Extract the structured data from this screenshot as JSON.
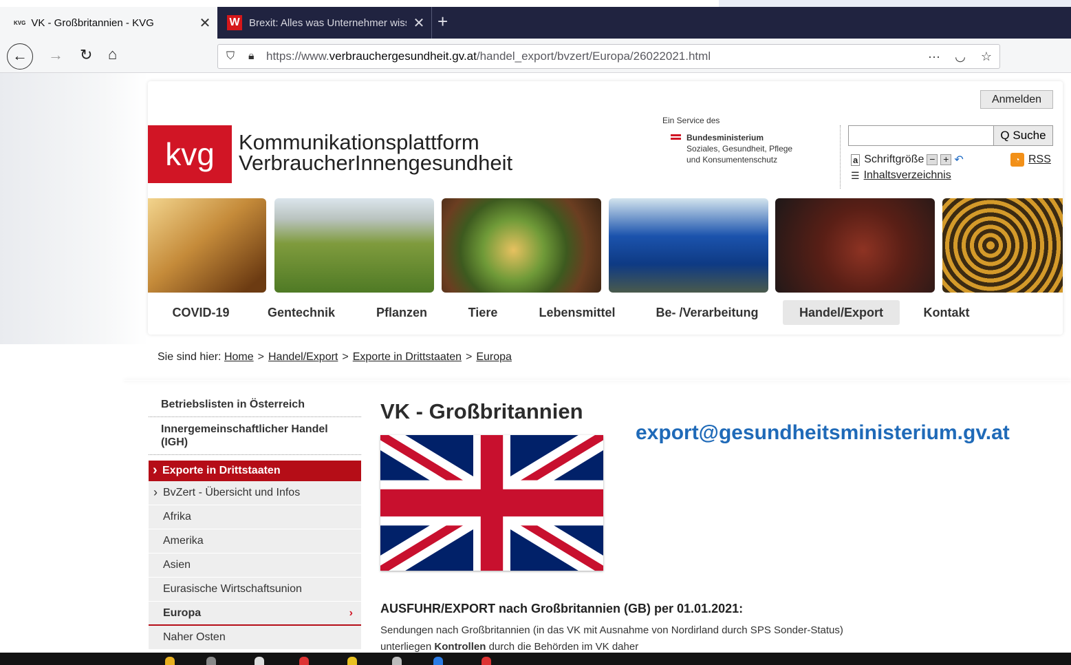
{
  "browser": {
    "tabs": [
      {
        "favicon": "KVG",
        "title": "VK - Großbritannien - KVG",
        "close": "✕"
      },
      {
        "favicon": "W",
        "title": "Brexit: Alles was Unternehmer wissen",
        "close": "✕"
      }
    ],
    "new_tab": "+",
    "url_prefix": "https://www.",
    "url_domain": "verbrauchergesundheit.gv.at",
    "url_path": "/handel_export/bvzert/Europa/26022021.html",
    "url_more": "···"
  },
  "header": {
    "login_label": "Anmelden",
    "logo_mark": "kvg",
    "logo_line1": "Kommunikationsplattform",
    "logo_line2": "VerbraucherInnengesundheit",
    "service_of": "Ein Service des",
    "ministry_name": "Bundesministerium",
    "ministry_line2": "Soziales, Gesundheit, Pflege",
    "ministry_line3": "und Konsumentenschutz",
    "search_button": "Q Suche",
    "font_size_icon": "a",
    "font_size_label": "Schriftgröße",
    "font_decrease": "−",
    "font_increase": "+",
    "rss_label": "RSS",
    "index_label": "Inhaltsverzeichnis"
  },
  "nav": [
    {
      "label": "COVID-19"
    },
    {
      "label": "Gentechnik"
    },
    {
      "label": "Pflanzen"
    },
    {
      "label": "Tiere"
    },
    {
      "label": "Lebensmittel"
    },
    {
      "label": "Be- /Verarbeitung"
    },
    {
      "label": "Handel/Export"
    },
    {
      "label": "Kontakt"
    }
  ],
  "breadcrumb": {
    "prefix": "Sie sind hier:",
    "items": [
      "Home",
      "Handel/Export",
      "Exporte in Drittstaaten",
      "Europa"
    ],
    "separator": ">"
  },
  "sidebar": {
    "top_items": [
      "Betriebslisten in Österreich",
      "Innergemeinschaftlicher Handel (IGH)"
    ],
    "active_section": "Exporte in Drittstaaten",
    "sub_items": [
      "BvZert - Übersicht und Infos",
      "Afrika",
      "Amerika",
      "Asien",
      "Eurasische Wirtschaftsunion",
      "Europa",
      "Naher Osten"
    ],
    "europa_chevron": "›"
  },
  "content": {
    "title": "VK - Großbritannien",
    "email": "export@gesundheitsministerium.gv.at",
    "heading_bold": "AUSFUHR/EXPORT",
    "heading_rest": " nach Großbritannien (GB) per 01.01.2021:",
    "text_part1": "Sendungen nach Großbritannien (in das VK mit Ausnahme von Nordirland durch SPS Sonder-Status) unterliegen ",
    "text_bold": "Kontrollen",
    "text_part2": " durch die Behörden im VK daher"
  },
  "colors": {
    "brand_red": "#d11525",
    "sidebar_red": "#b50d17",
    "email_blue": "#1f6ab8",
    "tabbar_bg": "#202340"
  }
}
